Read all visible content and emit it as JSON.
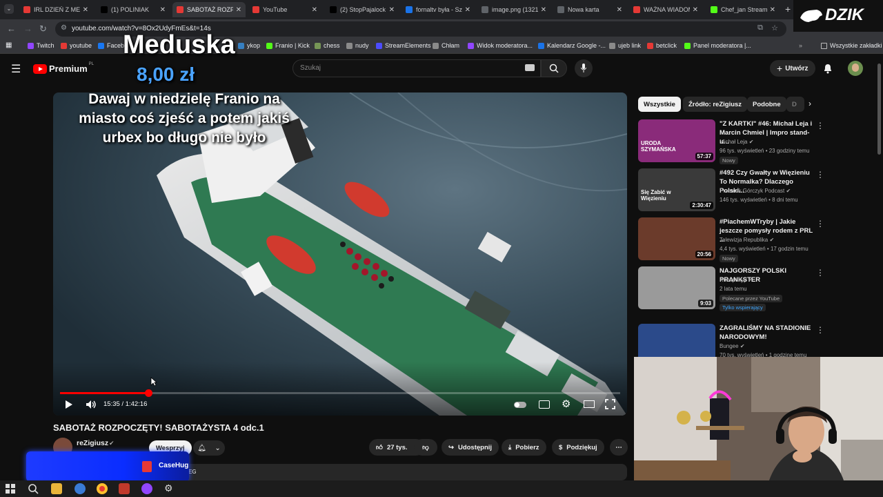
{
  "browser": {
    "tabs": [
      {
        "title": "IRL DZIEŃ Z MED",
        "color": "#e53935"
      },
      {
        "title": "(1) POLINIAK",
        "color": "#000000"
      },
      {
        "title": "SABOTAŻ ROZPO",
        "color": "#e53935"
      },
      {
        "title": "YouTube",
        "color": "#e53935"
      },
      {
        "title": "(2) StopPajalock",
        "color": "#000000"
      },
      {
        "title": "fornaltv była - Sz",
        "color": "#1a73e8"
      },
      {
        "title": "image.png (1321",
        "color": "#5f6368"
      },
      {
        "title": "Nowa karta",
        "color": "#5f6368"
      },
      {
        "title": "WAŻNA WIADOM",
        "color": "#e53935"
      },
      {
        "title": "Chef_jan Stream",
        "color": "#53fc18"
      }
    ],
    "url": "youtube.com/watch?v=8Ox2UdyFmEs&t=14s",
    "bookmarks": [
      {
        "label": "Twitch",
        "color": "#9146ff"
      },
      {
        "label": "youtube",
        "color": "#e53935"
      },
      {
        "label": "Facebo",
        "color": "#1877f2"
      },
      {
        "label": "ykop",
        "color": "#367fc1"
      },
      {
        "label": "Franio | Kick",
        "color": "#53fc18"
      },
      {
        "label": "chess",
        "color": "#769656"
      },
      {
        "label": "nudy",
        "color": "#8a8a8a"
      },
      {
        "label": "StreamElements",
        "color": "#4c4cff"
      },
      {
        "label": "Chłam",
        "color": "#8a8a8a"
      },
      {
        "label": "Widok moderatora...",
        "color": "#9146ff"
      },
      {
        "label": "Kalendarz Google -...",
        "color": "#1a73e8"
      },
      {
        "label": "ujeb link",
        "color": "#8a8a8a"
      },
      {
        "label": "betclick",
        "color": "#e53935"
      },
      {
        "label": "Panel moderatora |...",
        "color": "#53fc18"
      }
    ],
    "all_bookmarks": "Wszystkie zakładki"
  },
  "youtube": {
    "logo": "Premium",
    "logo_region": "PL",
    "search_placeholder": "Szukaj",
    "create_label": "Utwórz"
  },
  "overlays": {
    "donor_name": "Meduska",
    "donation_amount": "8,00 zł",
    "donation_message": "Dawaj w niedzielę Franio na miasto coś zjeść a potem jakiś urbex bo długo nie było",
    "brand_logo": "DZIK",
    "sponsor_logo": "CaseHug"
  },
  "player": {
    "time_current": "15:35",
    "time_total": "1:42:16",
    "progress_fraction": 0.158
  },
  "video": {
    "title": "SABOTAŻ ROZPOCZĘTY! SABOTAŻYSTA 4 odc.1",
    "channel": "reZigiusz",
    "support_label": "Wesprzyj",
    "likes": "27 tys.",
    "share_label": "Udostępnij",
    "download_label": "Pobierz",
    "thanks_label": "Podziękuj",
    "desc_fragment": "EG"
  },
  "filters": [
    "Wszystkie",
    "Źródło: reZigiusz",
    "Podobne",
    "D"
  ],
  "recommendations": [
    {
      "title": "\"Z KARTKI\" #46: Michał Leja i Marcin Chmiel | Impro stand-u...",
      "channel": "Michał Leja",
      "meta": "96 tys. wyświetleń • 23 godziny temu",
      "badge": "Nowy",
      "duration": "57:37",
      "thumb_text": "URODA SZYMAŃSKA",
      "thumb_color": "#8a2b7a"
    },
    {
      "title": "#492 Czy Gwałty w Więzieniu To Normalka? Dlaczego Polski...",
      "channel": "Przemek Górczyk Podcast",
      "meta": "146 tys. wyświetleń • 8 dni temu",
      "badge": "",
      "duration": "2:30:47",
      "thumb_text": "Się Zabić w Więzieniu",
      "thumb_color": "#3a3a3a"
    },
    {
      "title": "#PiachemWTryby | Jakie jeszcze pomysły rodem z PRL ...",
      "channel": "Telewizja Republika",
      "meta": "4,4 tys. wyświetleń • 17 godzin temu",
      "badge": "Nowy",
      "duration": "20:56",
      "thumb_text": "",
      "thumb_color": "#6b3b2b"
    },
    {
      "title": "NAJGORSZY POLSKI PRANKSTER",
      "channel": "Konopskyy",
      "meta": "2 lata temu",
      "badge": "Polecane przez YouTube",
      "badge2": "Tylko wspierający",
      "duration": "9:03",
      "thumb_text": "",
      "thumb_color": "#9a9a9a"
    },
    {
      "title": "ZAGRALIŚMY NA STADIONIE NARODOWYM!",
      "channel": "Bungee",
      "meta": "70 tys. wyświetleń • 1 godzinę temu",
      "badge": "",
      "duration": "",
      "thumb_text": "",
      "thumb_color": "#2b4a8a"
    }
  ]
}
